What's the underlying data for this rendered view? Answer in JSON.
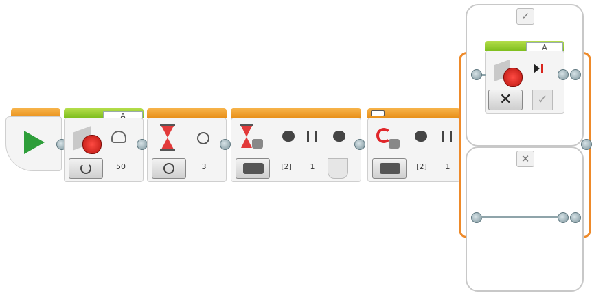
{
  "blocks": {
    "start": {
      "icon": "play-icon"
    },
    "motor": {
      "port": "A",
      "mode_icon": "rotate-icon",
      "power": "50"
    },
    "wait_time": {
      "mode_icon": "timer-icon",
      "seconds": "3"
    },
    "wait_brick": {
      "mode_icon": "brick-icon",
      "port": "[2]",
      "pressed": "1"
    },
    "switch": {
      "mode_icon": "brick-icon",
      "port": "[2]",
      "pressed": "1"
    },
    "case_motor": {
      "port": "A",
      "mode_icon": "x-icon"
    }
  },
  "switch_cases": {
    "true_tab": "✓",
    "false_tab": "✕"
  },
  "colors": {
    "orange": "#e8901a",
    "green": "#7fbf1e",
    "play": "#2e9e3a",
    "motor_red": "#d9251d"
  }
}
